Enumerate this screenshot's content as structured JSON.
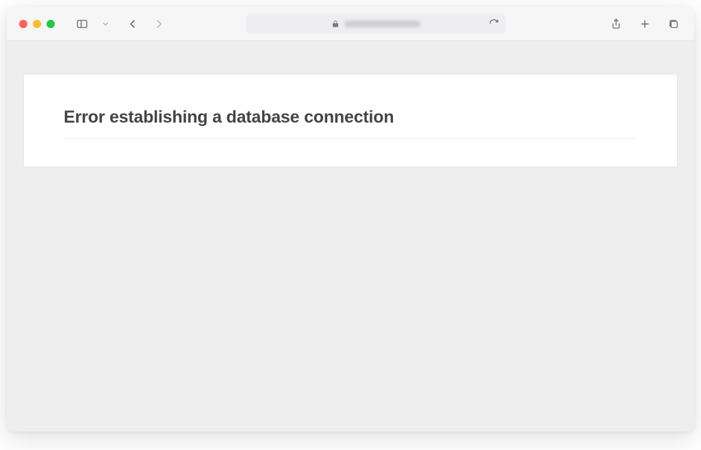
{
  "browser": {
    "address_url_obscured": true
  },
  "page": {
    "error_heading": "Error establishing a database connection"
  }
}
